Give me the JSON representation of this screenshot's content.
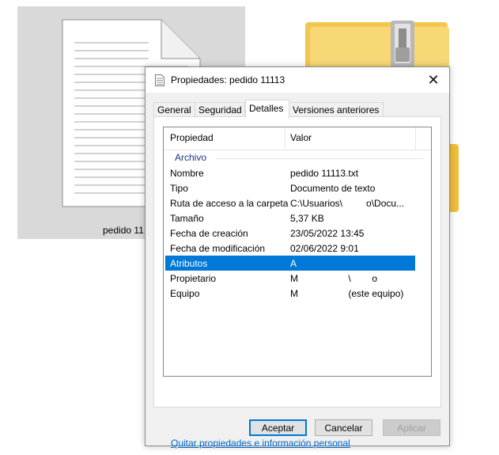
{
  "background": {
    "file_label": "pedido 11"
  },
  "dialog": {
    "title": "Propiedades: pedido 11113",
    "close_glyph": "✕",
    "tabs": [
      {
        "label": "General"
      },
      {
        "label": "Seguridad"
      },
      {
        "label": "Detalles"
      },
      {
        "label": "Versiones anteriores"
      }
    ],
    "active_tab": "Detalles",
    "list": {
      "col_property": "Propiedad",
      "col_value": "Valor",
      "group": "Archivo",
      "rows": [
        {
          "property": "Nombre",
          "value": "pedido 11113.txt"
        },
        {
          "property": "Tipo",
          "value": "Documento de texto"
        },
        {
          "property": "Ruta de acceso a la carpeta",
          "value": "C:\\Usuarios\\         o\\Docu..."
        },
        {
          "property": "Tamaño",
          "value": "5,37 KB"
        },
        {
          "property": "Fecha de creación",
          "value": "23/05/2022 13:45"
        },
        {
          "property": "Fecha de modificación",
          "value": "02/06/2022 9:01"
        },
        {
          "property": "Atributos",
          "value": "A"
        },
        {
          "property": "Propietario",
          "value": "M                   \\        o"
        },
        {
          "property": "Equipo",
          "value": "M                   (este equipo)"
        }
      ],
      "selected_row": "Atributos"
    },
    "link": "Quitar propiedades e información personal",
    "buttons": {
      "ok": "Aceptar",
      "cancel": "Cancelar",
      "apply": "Aplicar"
    }
  },
  "colors": {
    "selection": "#0078d7",
    "group_text": "#1e3287",
    "link": "#0066cc",
    "folder": "#f8d775"
  },
  "icons": {
    "title": "text-document-icon",
    "background_file": "text-document-icon",
    "background_folder": "zip-folder-icon"
  }
}
